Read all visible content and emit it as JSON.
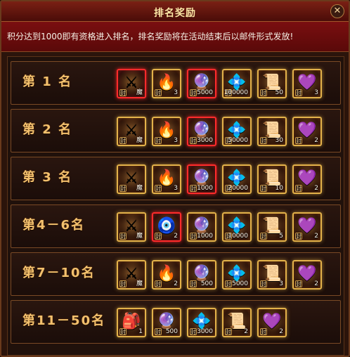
{
  "window": {
    "title": "排名奖励",
    "close_glyph": "✕",
    "notice": "积分达到1000即有资格进入排名，排名奖励将在活动结束后以邮件形式发放!"
  },
  "theme": {
    "title_bar": "#6a1a10",
    "notice_bg": "#6b0b0c",
    "rank_text": "#f2c06d",
    "frame_red": "#ff2b2b",
    "frame_gold": "#e3b24a",
    "frame_purple": "#9a3bd8"
  },
  "rows": [
    {
      "rank": "第 1 名",
      "items": [
        {
          "icon": "sword-icon",
          "frame": "red",
          "glyph": "⚔",
          "count": "魔",
          "bind": "封"
        },
        {
          "icon": "fire-bag-icon",
          "frame": "gold",
          "glyph": "🔥",
          "count": "3",
          "bind": "封"
        },
        {
          "icon": "blue-orb-icon",
          "frame": "red",
          "glyph": "🔮",
          "count": "5000",
          "bind": "封"
        },
        {
          "icon": "dark-orb-icon",
          "frame": "gold",
          "glyph": "💠",
          "count": "100000",
          "bind": "封"
        },
        {
          "icon": "scroll-icon",
          "frame": "gold",
          "glyph": "📜",
          "count": "50",
          "bind": "封"
        },
        {
          "icon": "purple-pearl-icon",
          "frame": "gold",
          "glyph": "💜",
          "count": "3",
          "bind": "封"
        }
      ]
    },
    {
      "rank": "第 2 名",
      "items": [
        {
          "icon": "sword-icon",
          "frame": "gold",
          "glyph": "⚔",
          "count": "魔",
          "bind": "封"
        },
        {
          "icon": "fire-bag-icon",
          "frame": "gold",
          "glyph": "🔥",
          "count": "3",
          "bind": "封"
        },
        {
          "icon": "blue-orb-icon",
          "frame": "red",
          "glyph": "🔮",
          "count": "3000",
          "bind": "封"
        },
        {
          "icon": "dark-orb-icon",
          "frame": "gold",
          "glyph": "💠",
          "count": "50000",
          "bind": "封"
        },
        {
          "icon": "scroll-icon",
          "frame": "gold",
          "glyph": "📜",
          "count": "30",
          "bind": "封"
        },
        {
          "icon": "purple-pearl-icon",
          "frame": "gold",
          "glyph": "💜",
          "count": "2",
          "bind": "封"
        }
      ]
    },
    {
      "rank": "第 3 名",
      "items": [
        {
          "icon": "sword-icon",
          "frame": "gold",
          "glyph": "⚔",
          "count": "魔",
          "bind": "封"
        },
        {
          "icon": "fire-bag-icon",
          "frame": "gold",
          "glyph": "🔥",
          "count": "3",
          "bind": "封"
        },
        {
          "icon": "blue-orb-icon",
          "frame": "red",
          "glyph": "🔮",
          "count": "1000",
          "bind": "封"
        },
        {
          "icon": "dark-orb-icon",
          "frame": "gold",
          "glyph": "💠",
          "count": "20000",
          "bind": "封"
        },
        {
          "icon": "scroll-icon",
          "frame": "gold",
          "glyph": "📜",
          "count": "10",
          "bind": "封"
        },
        {
          "icon": "purple-pearl-icon",
          "frame": "gold",
          "glyph": "💜",
          "count": "2",
          "bind": "封"
        }
      ]
    },
    {
      "rank": "第4－6名",
      "items": [
        {
          "icon": "sword-icon",
          "frame": "gold",
          "glyph": "⚔",
          "count": "魔",
          "bind": "封"
        },
        {
          "icon": "blue-bag-icon",
          "frame": "red",
          "glyph": "🧿",
          "count": "2",
          "bind": "封"
        },
        {
          "icon": "blue-orb-icon",
          "frame": "gold",
          "glyph": "🔮",
          "count": "1000",
          "bind": "封"
        },
        {
          "icon": "dark-orb-icon",
          "frame": "gold",
          "glyph": "💠",
          "count": "10000",
          "bind": "封"
        },
        {
          "icon": "scroll-icon",
          "frame": "gold",
          "glyph": "📜",
          "count": "5",
          "bind": "封"
        },
        {
          "icon": "purple-pearl-icon",
          "frame": "gold",
          "glyph": "💜",
          "count": "2",
          "bind": "封"
        }
      ]
    },
    {
      "rank": "第7－10名",
      "items": [
        {
          "icon": "sword-icon",
          "frame": "gold",
          "glyph": "⚔",
          "count": "魔",
          "bind": "封"
        },
        {
          "icon": "fire-bag-icon",
          "frame": "gold",
          "glyph": "🔥",
          "count": "2",
          "bind": "封"
        },
        {
          "icon": "blue-orb-icon",
          "frame": "gold",
          "glyph": "🔮",
          "count": "500",
          "bind": "封"
        },
        {
          "icon": "dark-orb-icon",
          "frame": "gold",
          "glyph": "💠",
          "count": "5000",
          "bind": "封"
        },
        {
          "icon": "scroll-icon",
          "frame": "gold",
          "glyph": "📜",
          "count": "3",
          "bind": "封"
        },
        {
          "icon": "purple-pearl-icon",
          "frame": "gold",
          "glyph": "💜",
          "count": "2",
          "bind": "封"
        }
      ]
    },
    {
      "rank": "第11－50名",
      "items": [
        {
          "icon": "green-bag-icon",
          "frame": "gold",
          "glyph": "🎒",
          "count": "1",
          "bind": "封"
        },
        {
          "icon": "blue-orb-icon",
          "frame": "gold",
          "glyph": "🔮",
          "count": "500",
          "bind": "封"
        },
        {
          "icon": "dark-orb-icon",
          "frame": "gold",
          "glyph": "💠",
          "count": "3000",
          "bind": "封"
        },
        {
          "icon": "scroll-icon",
          "frame": "gold",
          "glyph": "📜",
          "count": "2",
          "bind": "封"
        },
        {
          "icon": "purple-pearl-icon",
          "frame": "gold",
          "glyph": "💜",
          "count": "2",
          "bind": "封"
        }
      ]
    }
  ]
}
